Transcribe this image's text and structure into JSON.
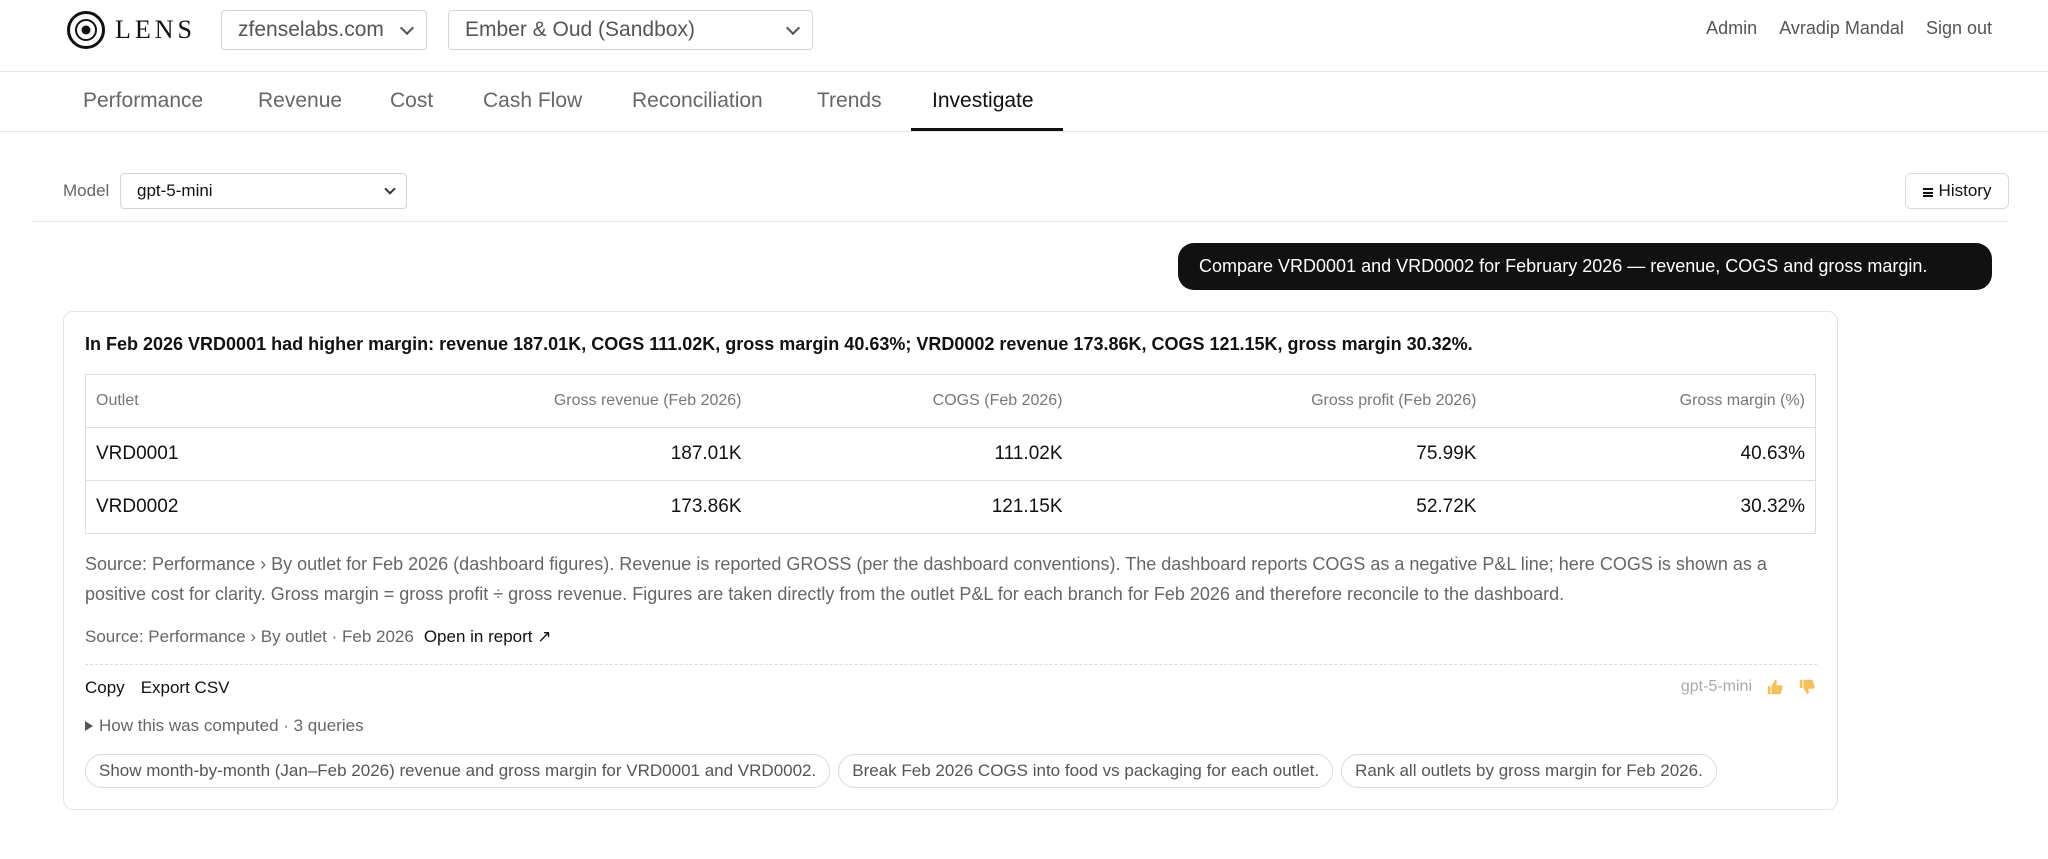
{
  "header": {
    "logo_text": "LENS",
    "org_select": "zfenselabs.com",
    "env_select": "Ember & Oud (Sandbox)",
    "links": [
      "Admin",
      "Avradip Mandal",
      "Sign out"
    ]
  },
  "tabs": [
    {
      "label": "Performance"
    },
    {
      "label": "Revenue"
    },
    {
      "label": "Cost"
    },
    {
      "label": "Cash Flow"
    },
    {
      "label": "Reconciliation"
    },
    {
      "label": "Trends"
    },
    {
      "label": "Investigate"
    }
  ],
  "active_tab": "Investigate",
  "model": {
    "label": "Model",
    "selected": "gpt-5-mini",
    "history_label": "History"
  },
  "user_message": "Compare VRD0001 and VRD0002 for February 2026 — revenue, COGS and gross margin.",
  "answer": {
    "summary": "In Feb 2026 VRD0001 had higher margin: revenue 187.01K, COGS 111.02K, gross margin 40.63%; VRD0002 revenue 173.86K, COGS 121.15K, gross margin 30.32%.",
    "table": {
      "headers": [
        "Outlet",
        "Gross revenue (Feb 2026)",
        "COGS (Feb 2026)",
        "Gross profit (Feb 2026)",
        "Gross margin (%)"
      ],
      "rows": [
        [
          "VRD0001",
          "187.01K",
          "111.02K",
          "75.99K",
          "40.63%"
        ],
        [
          "VRD0002",
          "173.86K",
          "121.15K",
          "52.72K",
          "30.32%"
        ]
      ]
    },
    "note": "Source: Performance › By outlet for Feb 2026 (dashboard figures). Revenue is reported GROSS (per the dashboard conventions). The dashboard reports COGS as a negative P&L line; here COGS is shown as a positive cost for clarity. Gross margin = gross profit ÷ gross revenue. Figures are taken directly from the outlet P&L for each branch for Feb 2026 and therefore reconcile to the dashboard.",
    "source_line": "Source: Performance › By outlet · Feb 2026",
    "open_report": "Open in report ↗",
    "copy_label": "Copy",
    "export_label": "Export CSV",
    "model_tag": "gpt-5-mini",
    "computed_label": "How this was computed · 3 queries",
    "suggestions": [
      "Show month-by-month (Jan–Feb 2026) revenue and gross margin for VRD0001 and VRD0002.",
      "Break Feb 2026 COGS into food vs packaging for each outlet.",
      "Rank all outlets by gross margin for Feb 2026."
    ]
  },
  "colors": {
    "accent": "#111111",
    "muted_text": "#666666",
    "border": "#e4e4e4"
  }
}
